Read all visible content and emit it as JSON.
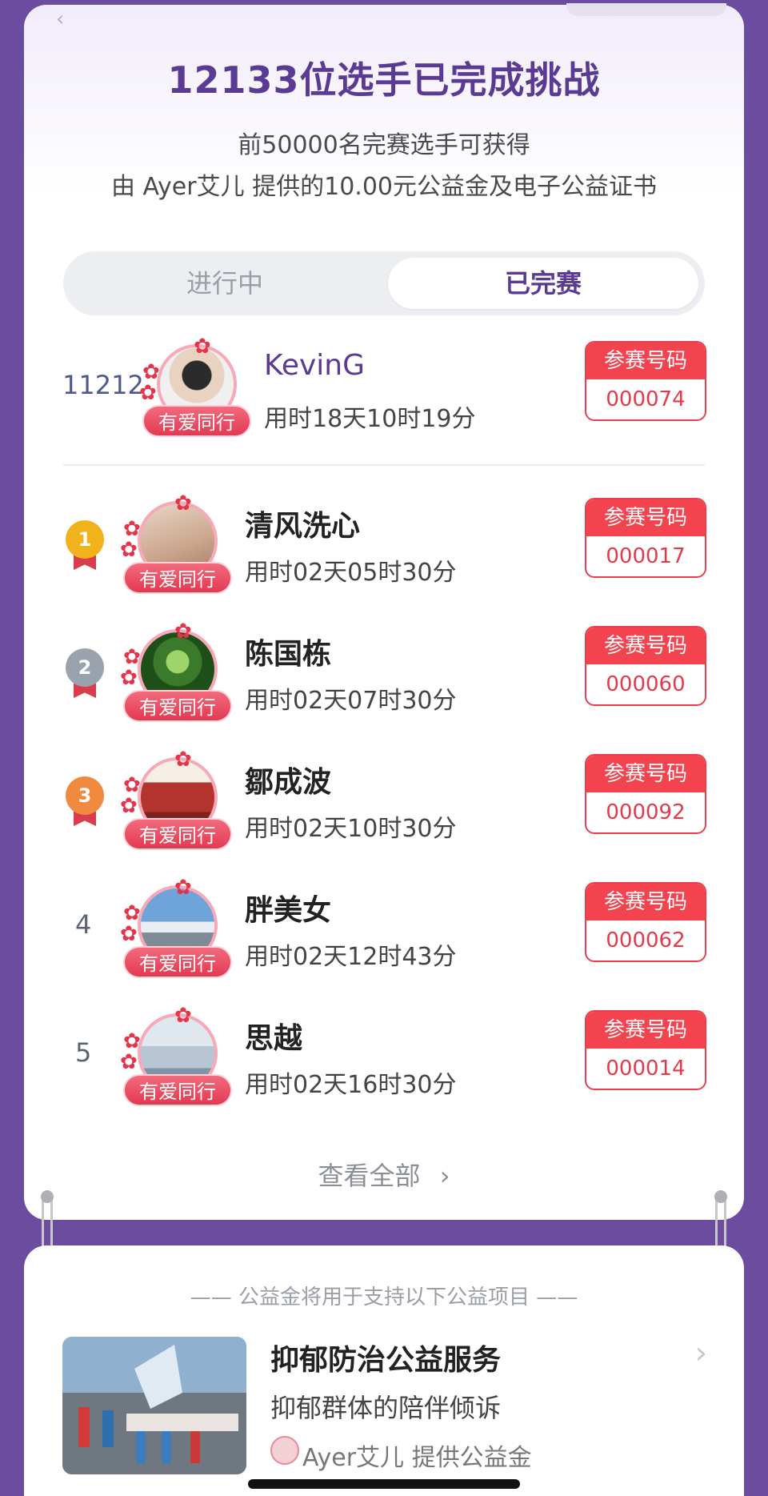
{
  "header": {
    "headline": "12133位选手已完成挑战",
    "sub1": "前50000名完赛选手可获得",
    "sub2": "由 Ayer艾儿 提供的10.00元公益金及电子公益证书"
  },
  "tabs": {
    "in_progress": "进行中",
    "finished": "已完赛",
    "active": "finished"
  },
  "my_entry": {
    "rank": "11212",
    "name": "KevinG",
    "time": "用时18天10时19分",
    "badge": "有爱同行",
    "bib_label": "参赛号码",
    "bib_number": "000074"
  },
  "leaderboard": [
    {
      "rank": "1",
      "name": "清风洗心",
      "time": "用时02天05时30分",
      "badge": "有爱同行",
      "bib_label": "参赛号码",
      "bib_number": "000017",
      "medal": "gold"
    },
    {
      "rank": "2",
      "name": "陈国栋",
      "time": "用时02天07时30分",
      "badge": "有爱同行",
      "bib_label": "参赛号码",
      "bib_number": "000060",
      "medal": "silver"
    },
    {
      "rank": "3",
      "name": "鄒成波",
      "time": "用时02天10时30分",
      "badge": "有爱同行",
      "bib_label": "参赛号码",
      "bib_number": "000092",
      "medal": "bronze"
    },
    {
      "rank": "4",
      "name": "胖美女",
      "time": "用时02天12时43分",
      "badge": "有爱同行",
      "bib_label": "参赛号码",
      "bib_number": "000062"
    },
    {
      "rank": "5",
      "name": "思越",
      "time": "用时02天16时30分",
      "badge": "有爱同行",
      "bib_label": "参赛号码",
      "bib_number": "000014"
    }
  ],
  "view_all": "查看全部",
  "charity": {
    "section_title": "—— 公益金将用于支持以下公益项目 ——",
    "project_title": "抑郁防治公益服务",
    "project_desc": "抑郁群体的陪伴倾诉",
    "sponsor": "Ayer艾儿 提供公益金"
  },
  "colors": {
    "background": "#6b4c9e",
    "accent": "#5b3a94",
    "bib_red": "#f2434f",
    "gold": "#f2b21b",
    "silver": "#9aa3ad",
    "bronze": "#ef8a3f"
  },
  "icons": [
    "back-icon",
    "chevron-right-icon",
    "medal-icon",
    "flower-icon",
    "sponsor-logo-icon"
  ]
}
